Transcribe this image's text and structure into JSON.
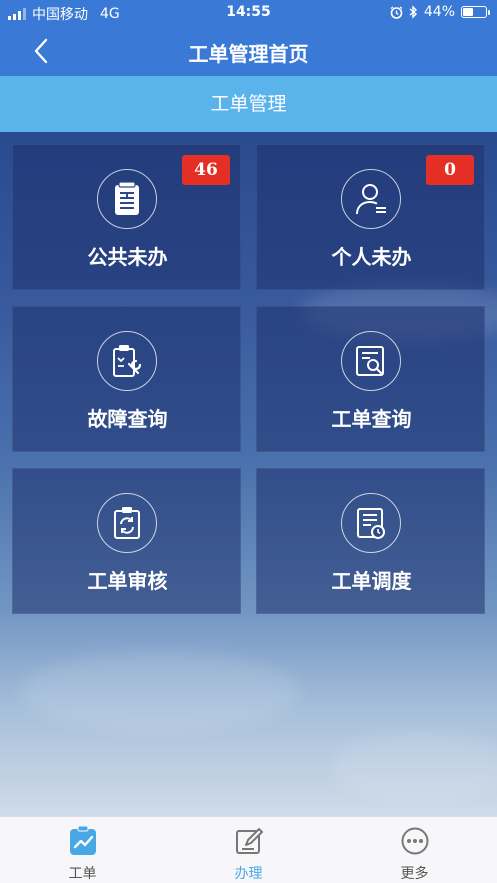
{
  "status_bar": {
    "carrier": "中国移动",
    "network": "4G",
    "time": "14:55",
    "battery_percent": "44%",
    "battery_level": 0.44,
    "icons": [
      "alarm-icon",
      "bluetooth-icon",
      "battery-icon"
    ]
  },
  "nav": {
    "title": "工单管理首页",
    "back_icon": "back-chevron-icon"
  },
  "section": {
    "title": "工单管理"
  },
  "tiles": [
    {
      "label": "公共未办",
      "badge": "46",
      "icon": "document-list-icon"
    },
    {
      "label": "个人未办",
      "badge": "0",
      "icon": "user-icon"
    },
    {
      "label": "故障查询",
      "icon": "clipboard-wrench-icon"
    },
    {
      "label": "工单查询",
      "icon": "document-search-icon"
    },
    {
      "label": "工单审核",
      "icon": "clipboard-refresh-icon"
    },
    {
      "label": "工单调度",
      "icon": "document-clock-icon"
    }
  ],
  "tab_bar": {
    "items": [
      {
        "label": "工单",
        "icon": "chart-icon"
      },
      {
        "label": "办理",
        "icon": "edit-icon",
        "active": true
      },
      {
        "label": "更多",
        "icon": "more-dots-icon"
      }
    ]
  },
  "colors": {
    "nav": "#3a7ad6",
    "section_header": "#5bb3ec",
    "badge": "#e52f24",
    "tab_active": "#4aa7e6"
  }
}
